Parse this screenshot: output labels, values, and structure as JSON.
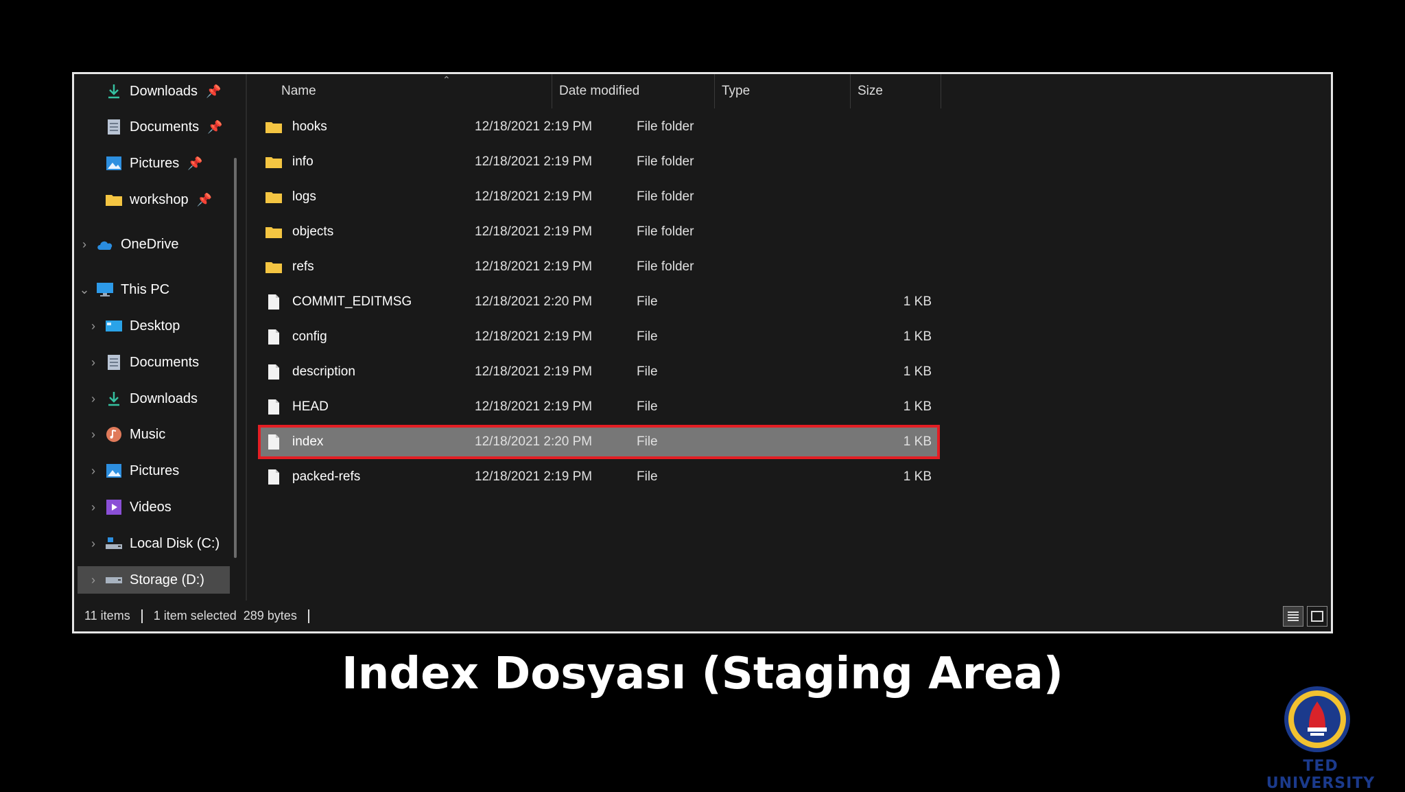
{
  "nav": {
    "items": [
      {
        "label": "Downloads",
        "icon": "download-icon",
        "pinned": true
      },
      {
        "label": "Documents",
        "icon": "document-icon",
        "pinned": true
      },
      {
        "label": "Pictures",
        "icon": "pictures-icon",
        "pinned": true
      },
      {
        "label": "workshop",
        "icon": "folder-icon",
        "pinned": true
      },
      {
        "label": "OneDrive",
        "icon": "cloud-icon",
        "expanded": false
      },
      {
        "label": "This PC",
        "icon": "pc-icon",
        "expanded": true
      },
      {
        "label": "Desktop",
        "icon": "desktop-icon"
      },
      {
        "label": "Documents",
        "icon": "document-icon"
      },
      {
        "label": "Downloads",
        "icon": "download-icon"
      },
      {
        "label": "Music",
        "icon": "music-icon"
      },
      {
        "label": "Pictures",
        "icon": "pictures-icon"
      },
      {
        "label": "Videos",
        "icon": "videos-icon"
      },
      {
        "label": "Local Disk (C:)",
        "icon": "disk-icon"
      },
      {
        "label": "Storage (D:)",
        "icon": "drive-icon",
        "selected": true
      }
    ]
  },
  "columns": {
    "name": "Name",
    "date": "Date modified",
    "type": "Type",
    "size": "Size"
  },
  "files": [
    {
      "name": "hooks",
      "date": "12/18/2021 2:19 PM",
      "type": "File folder",
      "size": "",
      "kind": "folder"
    },
    {
      "name": "info",
      "date": "12/18/2021 2:19 PM",
      "type": "File folder",
      "size": "",
      "kind": "folder"
    },
    {
      "name": "logs",
      "date": "12/18/2021 2:19 PM",
      "type": "File folder",
      "size": "",
      "kind": "folder"
    },
    {
      "name": "objects",
      "date": "12/18/2021 2:19 PM",
      "type": "File folder",
      "size": "",
      "kind": "folder"
    },
    {
      "name": "refs",
      "date": "12/18/2021 2:19 PM",
      "type": "File folder",
      "size": "",
      "kind": "folder"
    },
    {
      "name": "COMMIT_EDITMSG",
      "date": "12/18/2021 2:20 PM",
      "type": "File",
      "size": "1 KB",
      "kind": "file"
    },
    {
      "name": "config",
      "date": "12/18/2021 2:19 PM",
      "type": "File",
      "size": "1 KB",
      "kind": "file"
    },
    {
      "name": "description",
      "date": "12/18/2021 2:19 PM",
      "type": "File",
      "size": "1 KB",
      "kind": "file"
    },
    {
      "name": "HEAD",
      "date": "12/18/2021 2:19 PM",
      "type": "File",
      "size": "1 KB",
      "kind": "file"
    },
    {
      "name": "index",
      "date": "12/18/2021 2:20 PM",
      "type": "File",
      "size": "1 KB",
      "kind": "file",
      "selected": true
    },
    {
      "name": "packed-refs",
      "date": "12/18/2021 2:19 PM",
      "type": "File",
      "size": "1 KB",
      "kind": "file"
    }
  ],
  "status": {
    "count": "11 items",
    "selection": "1 item selected",
    "bytes": "289 bytes"
  },
  "caption": "Index Dosyası (Staging Area)",
  "branding": {
    "text": "TED UNIVERSITY"
  },
  "colors": {
    "highlight_border": "#e31e24",
    "selected_row": "#777777",
    "folder": "#f4c542"
  }
}
